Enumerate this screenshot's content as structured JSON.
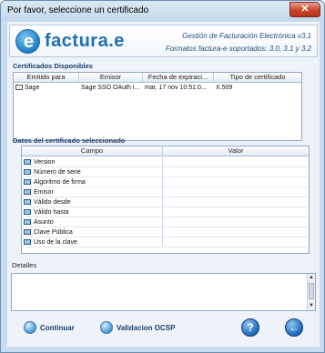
{
  "window": {
    "title": "Por favor, seleccione un certificado",
    "close_label": "✕"
  },
  "header": {
    "logo_letter": "e",
    "logo_text": "factura.e",
    "version": "Gestión de Facturación Electrónica v3.1",
    "formats": "Formatos factura-e soportados: 3.0, 3.1 y 3.2"
  },
  "certs": {
    "label": "Certificados Disponibles",
    "columns": [
      "Emitido para",
      "Emisor",
      "Fecha de expiraci...",
      "Tipo de certificado"
    ],
    "rows": [
      {
        "issued_to": "Sage",
        "issuer": "Sage SSO OAuth I...",
        "expiry": "mar, 17 nov 10:51:0...",
        "type": "X.509"
      }
    ]
  },
  "details_cert": {
    "label": "Datos del certificado seleccionado",
    "columns": [
      "Campo",
      "Valor"
    ],
    "fields": [
      "Version",
      "Número de serie",
      "Algoritmo de firma",
      "Emisor",
      "Válido desde",
      "Válido hasta",
      "Asunto",
      "Clave Pública",
      "Uso de la clave"
    ]
  },
  "details": {
    "label": "Detalles",
    "value": ""
  },
  "footer": {
    "continue_label": "Continuar",
    "ocsp_label": "Validacion OCSP",
    "help_label": "?",
    "back_label": "←"
  }
}
